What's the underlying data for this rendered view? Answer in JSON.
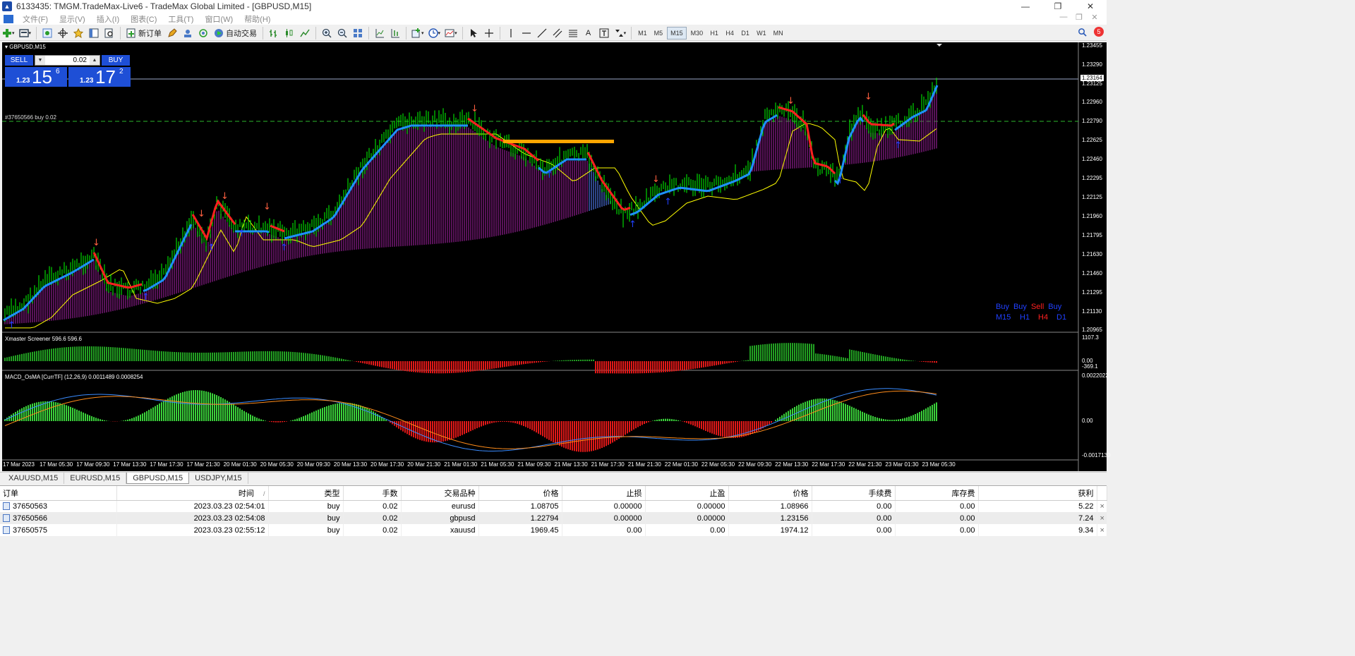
{
  "window": {
    "title": "6133435: TMGM.TradeMax-Live6 - TradeMax Global Limited - [GBPUSD,M15]",
    "buttons": [
      "—",
      "❐",
      "✕"
    ]
  },
  "menu": {
    "items": [
      "文件(F)",
      "显示(V)",
      "插入(I)",
      "图表(C)",
      "工具(T)",
      "窗口(W)",
      "帮助(H)"
    ],
    "mdi_buttons": [
      "—",
      "❐",
      "✕"
    ]
  },
  "toolbar": {
    "new_order_label": "新订单",
    "auto_trading_label": "自动交易",
    "timeframes": [
      "M1",
      "M5",
      "M15",
      "M30",
      "H1",
      "H4",
      "D1",
      "W1",
      "MN"
    ],
    "active_timeframe": "M15",
    "notification_count": "5"
  },
  "chart": {
    "symbol_label": "GBPUSD,M15",
    "position_label": "#37650566 buy 0.02",
    "current_price": "1.23164",
    "price_ticks": [
      "1.23455",
      "1.23290",
      "1.23125",
      "1.22960",
      "1.22790",
      "1.22625",
      "1.22460",
      "1.22295",
      "1.22125",
      "1.21960",
      "1.21795",
      "1.21630",
      "1.21460",
      "1.21295",
      "1.21130",
      "1.20965"
    ],
    "time_ticks": [
      "17 Mar 2023",
      "17 Mar 05:30",
      "17 Mar 09:30",
      "17 Mar 13:30",
      "17 Mar 17:30",
      "17 Mar 21:30",
      "20 Mar 01:30",
      "20 Mar 05:30",
      "20 Mar 09:30",
      "20 Mar 13:30",
      "20 Mar 17:30",
      "20 Mar 21:30",
      "21 Mar 01:30",
      "21 Mar 05:30",
      "21 Mar 09:30",
      "21 Mar 13:30",
      "21 Mar 17:30",
      "21 Mar 21:30",
      "22 Mar 01:30",
      "22 Mar 05:30",
      "22 Mar 09:30",
      "22 Mar 13:30",
      "22 Mar 17:30",
      "22 Mar 21:30",
      "23 Mar 01:30",
      "23 Mar 05:30"
    ],
    "colors": {
      "up_candle": "#00ff00",
      "trend_up": "#1e90ff",
      "trend_down": "#ff2020",
      "cloud": "#8b1e8b",
      "cloud_blue": "#4a6fd8",
      "ma_yellow": "#ffff00",
      "orange_bar": "#ffa500"
    },
    "xmaster": {
      "label": "Xmaster Screener 596.6 596.6",
      "ticks": [
        "1107.3",
        "0.00",
        "-369.1"
      ]
    },
    "macd": {
      "label": "MACD_OsMA [CurrTF] (12,26,9) 0.0011489 0.0008254",
      "ticks": [
        "0.0022022",
        "0.00",
        "-0.0017130"
      ]
    }
  },
  "trade_panel": {
    "sell_label": "SELL",
    "buy_label": "BUY",
    "lot": "0.02",
    "sell_small": "1.23",
    "sell_big": "15",
    "sell_sup": "6",
    "buy_small": "1.23",
    "buy_big": "17",
    "buy_sup": "2"
  },
  "signals": {
    "row1": [
      "Buy",
      "Buy",
      "Sell",
      "Buy"
    ],
    "row2": [
      "M15",
      "H1",
      "H4",
      "D1"
    ]
  },
  "symbol_tabs": [
    "XAUUSD,M15",
    "EURUSD,M15",
    "GBPUSD,M15",
    "USDJPY,M15"
  ],
  "active_tab": "GBPUSD,M15",
  "orders": {
    "headers": [
      "订单",
      "时间",
      "类型",
      "手数",
      "交易品种",
      "价格",
      "止损",
      "止盈",
      "价格",
      "手续费",
      "库存费",
      "获利"
    ],
    "sort_indicator": "/",
    "rows": [
      {
        "id": "37650563",
        "time": "2023.03.23 02:54:01",
        "type": "buy",
        "lots": "0.02",
        "symbol": "eurusd",
        "price": "1.08705",
        "sl": "0.00000",
        "tp": "0.00000",
        "cur_price": "1.08966",
        "commission": "0.00",
        "swap": "0.00",
        "profit": "5.22"
      },
      {
        "id": "37650566",
        "time": "2023.03.23 02:54:08",
        "type": "buy",
        "lots": "0.02",
        "symbol": "gbpusd",
        "price": "1.22794",
        "sl": "0.00000",
        "tp": "0.00000",
        "cur_price": "1.23156",
        "commission": "0.00",
        "swap": "0.00",
        "profit": "7.24"
      },
      {
        "id": "37650575",
        "time": "2023.03.23 02:55:12",
        "type": "buy",
        "lots": "0.02",
        "symbol": "xauusd",
        "price": "1969.45",
        "sl": "0.00",
        "tp": "0.00",
        "cur_price": "1974.12",
        "commission": "0.00",
        "swap": "0.00",
        "profit": "9.34"
      }
    ]
  }
}
